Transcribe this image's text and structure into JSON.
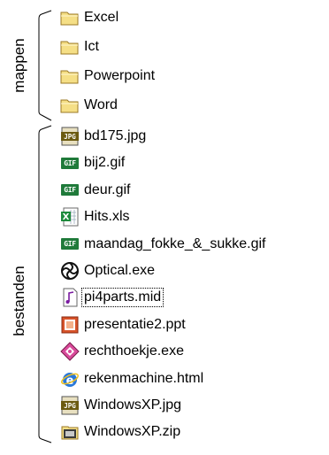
{
  "groups": {
    "mappen_label": "mappen",
    "bestanden_label": "bestanden"
  },
  "folders": [
    {
      "name": "Excel",
      "icon": "folder-icon"
    },
    {
      "name": "Ict",
      "icon": "folder-icon"
    },
    {
      "name": "Powerpoint",
      "icon": "folder-icon"
    },
    {
      "name": "Word",
      "icon": "folder-icon"
    }
  ],
  "files": [
    {
      "name": "bd175.jpg",
      "icon": "jpg-file-icon"
    },
    {
      "name": "bij2.gif",
      "icon": "gif-file-icon"
    },
    {
      "name": "deur.gif",
      "icon": "gif-file-icon"
    },
    {
      "name": "Hits.xls",
      "icon": "excel-file-icon"
    },
    {
      "name": "maandag_fokke_&_sukke.gif",
      "icon": "gif-file-icon"
    },
    {
      "name": "Optical.exe",
      "icon": "optical-exe-icon"
    },
    {
      "name": "pi4parts.mid",
      "icon": "midi-file-icon",
      "focused": true
    },
    {
      "name": "presentatie2.ppt",
      "icon": "powerpoint-file-icon"
    },
    {
      "name": "rechthoekje.exe",
      "icon": "app-exe-icon"
    },
    {
      "name": "rekenmachine.html",
      "icon": "internet-explorer-icon"
    },
    {
      "name": "WindowsXP.jpg",
      "icon": "jpg-file-icon"
    },
    {
      "name": "WindowsXP.zip",
      "icon": "zip-file-icon"
    }
  ],
  "colors": {
    "folder": "#f5df86",
    "folder_border": "#9b7a26",
    "gif_badge": "#1f7a3a",
    "jpg_badge": "#6b5a10",
    "excel": "#1d8a3c",
    "ppt": "#d8532a",
    "ie": "#2a78d8",
    "midi": "#7a1aa0"
  }
}
